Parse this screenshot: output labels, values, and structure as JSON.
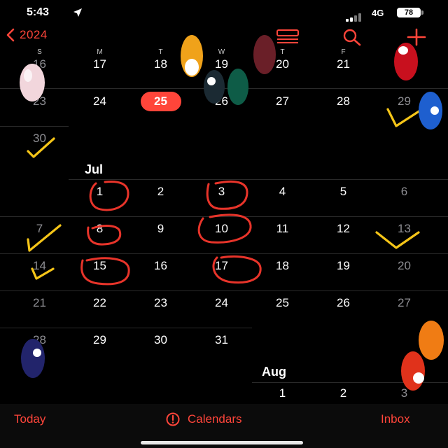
{
  "status_bar": {
    "time": "5:43",
    "network": "4G",
    "battery": "78"
  },
  "nav": {
    "back_label": "2024"
  },
  "weekdays": [
    "S",
    "M",
    "T",
    "W",
    "T",
    "F"
  ],
  "months": {
    "jul": "Jul",
    "aug": "Aug"
  },
  "rows": {
    "r1": [
      "16",
      "17",
      "18",
      "19",
      "20",
      "21"
    ],
    "r2": [
      "23",
      "24",
      "25",
      "26",
      "27",
      "28",
      "29"
    ],
    "r3": [
      "30"
    ],
    "r4": [
      "1",
      "2",
      "3",
      "4",
      "5",
      "6"
    ],
    "r5": [
      "7",
      "8",
      "9",
      "10",
      "11",
      "12",
      "13"
    ],
    "r6": [
      "14",
      "15",
      "16",
      "17",
      "18",
      "19",
      "20"
    ],
    "r7": [
      "21",
      "22",
      "23",
      "24",
      "25",
      "26",
      "27"
    ],
    "r8": [
      "28",
      "29",
      "30",
      "31"
    ],
    "r9": [
      "1",
      "2",
      "3"
    ]
  },
  "toolbar": {
    "today": "Today",
    "calendars": "Calendars",
    "inbox": "Inbox"
  },
  "icons": [
    "location-arrow-icon",
    "list-view-icon",
    "search-icon",
    "add-icon",
    "alert-circle-icon"
  ],
  "colors": {
    "accent": "#ff453a",
    "annotation_red": "#e8342a",
    "annotation_yellow": "#f5c518"
  }
}
